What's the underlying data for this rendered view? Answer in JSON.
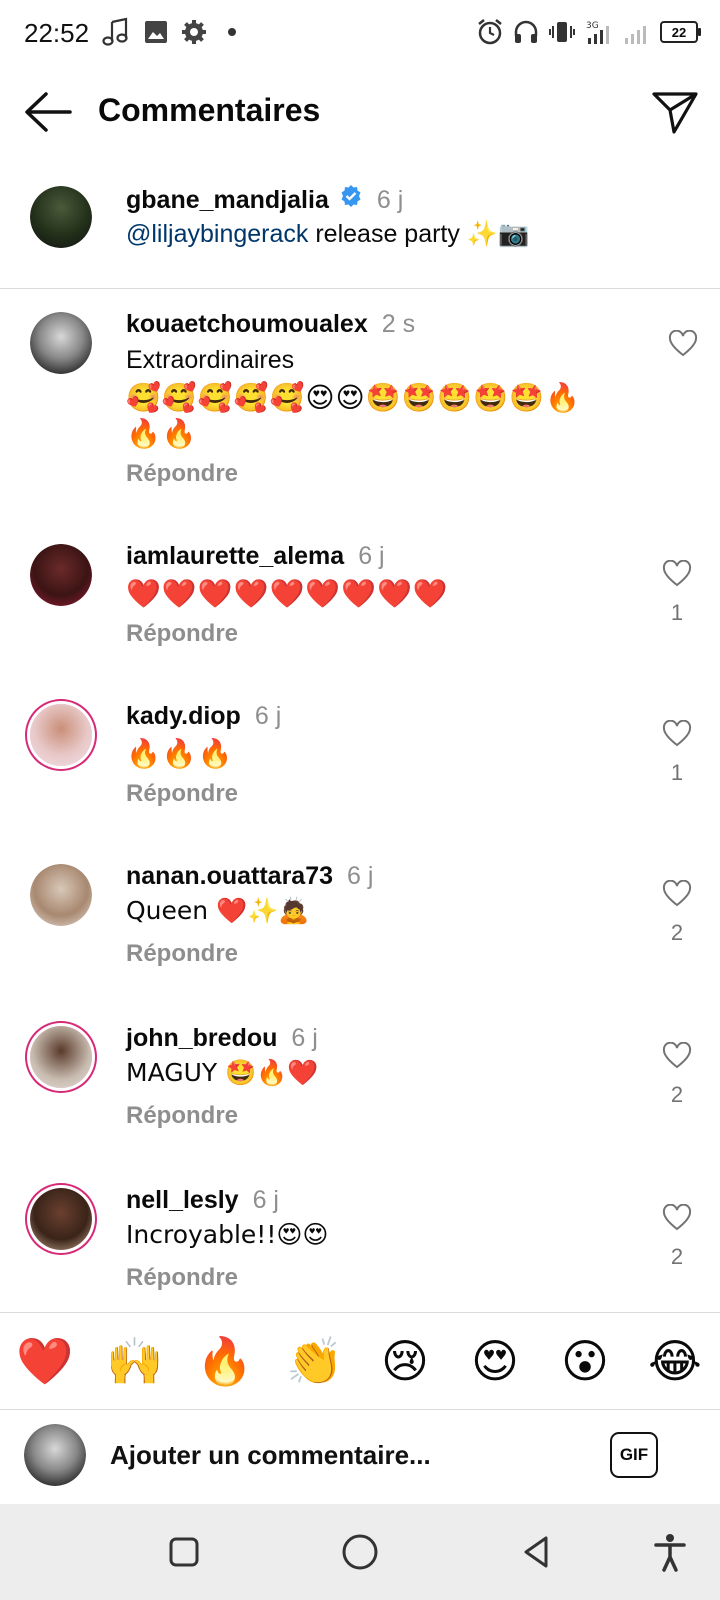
{
  "status_bar": {
    "time": "22:52",
    "battery": "22",
    "left_icons": [
      "music-note-icon",
      "image-icon",
      "gear-icon"
    ],
    "right_icons": [
      "alarm-icon",
      "headphones-icon",
      "vibrate-icon",
      "signal-3g-icon",
      "signal-icon"
    ]
  },
  "header": {
    "title": "Commentaires"
  },
  "caption": {
    "username": "gbane_mandjalia",
    "time": "6 j",
    "mention": "@liljaybingerack",
    "text": " release party ✨📷"
  },
  "comments": [
    {
      "username": "kouaetchoumoualex",
      "time": "2 s",
      "text": "Extraordinaires",
      "emoji_line1": "🥰🥰🥰🥰🥰😍😍🤩🤩🤩🤩🤩🔥",
      "emoji_line2": "🔥🔥",
      "reply": "Répondre",
      "likes": ""
    },
    {
      "username": "iamlaurette_alema",
      "time": "6 j",
      "text": "",
      "emoji_line1": "❤️❤️❤️❤️❤️❤️❤️❤️❤️",
      "reply": "Répondre",
      "likes": "1"
    },
    {
      "username": "kady.diop",
      "time": "6 j",
      "text": "",
      "emoji_line1": "🔥🔥🔥",
      "reply": "Répondre",
      "likes": "1"
    },
    {
      "username": "nanan.ouattara73",
      "time": "6 j",
      "text": "Queen ❤️✨🙇",
      "reply": "Répondre",
      "likes": "2"
    },
    {
      "username": "john_bredou",
      "time": "6 j",
      "text": "MAGUY 🤩🔥❤️",
      "reply": "Répondre",
      "likes": "2"
    },
    {
      "username": "nell_lesly",
      "time": "6 j",
      "text": "Incroyable!!😍😍",
      "reply": "Répondre",
      "likes": "2"
    }
  ],
  "reactions": [
    "❤️",
    "🙌",
    "🔥",
    "👏",
    "😢",
    "😍",
    "😮",
    "😂"
  ],
  "input": {
    "placeholder": "Ajouter un commentaire...",
    "gif_label": "GIF"
  },
  "colors": {
    "mention": "#00376b",
    "secondary_text": "#8e8e8e",
    "verified": "#3797f0",
    "story_ring": "#d62976"
  }
}
